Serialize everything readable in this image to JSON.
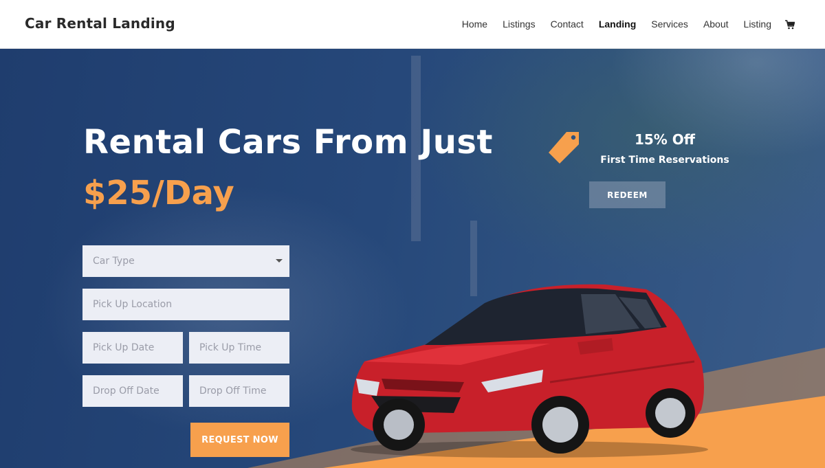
{
  "header": {
    "brand": "Car Rental Landing",
    "nav": [
      "Home",
      "Listings",
      "Contact",
      "Landing",
      "Services",
      "About",
      "Listing"
    ],
    "active": "Landing"
  },
  "hero": {
    "headline": "Rental Cars From Just",
    "price": "$25/Day"
  },
  "form": {
    "car_type": "Car Type",
    "pickup_location": "Pick Up Location",
    "pickup_date": "Pick Up Date",
    "pickup_time": "Pick Up Time",
    "dropoff_date": "Drop Off Date",
    "dropoff_time": "Drop Off Time",
    "submit": "REQUEST NOW"
  },
  "promo": {
    "title": "15% Off",
    "subtitle": "First Time Reservations",
    "button": "REDEEM"
  },
  "colors": {
    "accent": "#f7a04d",
    "hero_blue": "#26487a",
    "field_bg": "#eceef5",
    "car_red": "#c8202a"
  },
  "icons": [
    "cart-icon",
    "price-tag-icon",
    "dropdown-caret-icon"
  ]
}
